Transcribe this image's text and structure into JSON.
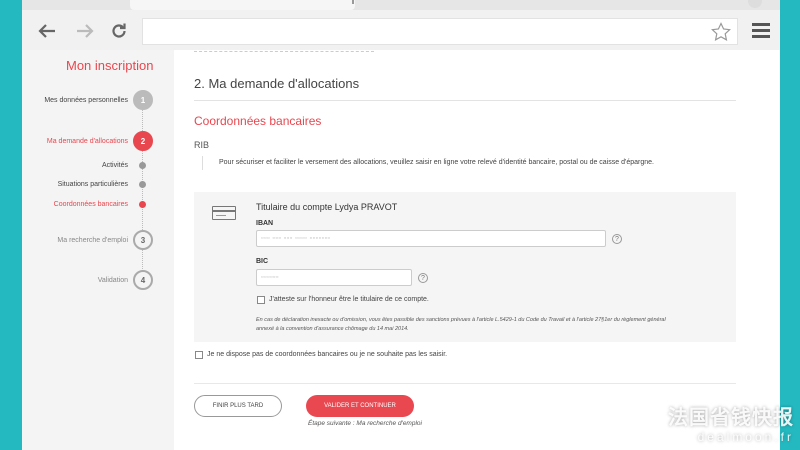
{
  "page": {
    "sidebar_title": "Mon inscription",
    "steps": [
      {
        "label": "Mes données personnelles",
        "number": "1",
        "state": "done"
      },
      {
        "label": "Ma demande d'allocations",
        "number": "2",
        "state": "active"
      },
      {
        "label": "Ma recherche d'emploi",
        "number": "3",
        "state": "todo"
      },
      {
        "label": "Validation",
        "number": "4",
        "state": "todo"
      }
    ],
    "substeps": [
      {
        "label": "Activités",
        "state": "done"
      },
      {
        "label": "Situations particulières",
        "state": "done"
      },
      {
        "label": "Coordonnées bancaires",
        "state": "active"
      }
    ],
    "section_title": "2. Ma demande d'allocations",
    "subsection_title": "Coordonnées bancaires",
    "rib_label": "RIB",
    "rib_note": "Pour sécuriser et faciliter le versement des allocations, veuillez saisir en ligne votre relevé d'identité bancaire, postal ou de caisse d'épargne.",
    "card": {
      "holder": "Titulaire du compte Lydya PRAVOT",
      "iban_label": "IBAN",
      "iban_value": "▫▫▫ ▫▫▫ ▫▫▫ ▫▫▫▫ ▫▫▫▫▫▫▫",
      "bic_label": "BIC",
      "bic_value": "▫▫▫▫▫▫",
      "attest_label": "J'atteste sur l'honneur être le titulaire de ce compte.",
      "legal": "En cas de déclaration inexacte ou d'omission, vous êtes passible des sanctions prévues à l'article L.5429-1 du Code du Travail et à l'article 27§1er du règlement général annexé à la convention d'assurance chômage du 14 mai 2014."
    },
    "no_bank_label": "Je ne dispose pas de coordonnées bancaires ou je ne souhaite pas les saisir.",
    "btn_later": "FINIR PLUS TARD",
    "btn_validate": "VALIDER ET CONTINUER",
    "next_step": "Étape suivante : Ma recherche d'emploi",
    "help_glyph": "?"
  },
  "watermark": {
    "line1": "法国省钱快报",
    "line2": "dealmoon.fr"
  },
  "colors": {
    "accent": "#e8474f",
    "teal": "#29c3c8"
  },
  "icons": [
    "back-arrow-icon",
    "forward-arrow-icon",
    "reload-icon",
    "star-icon",
    "menu-icon",
    "bank-card-icon"
  ]
}
